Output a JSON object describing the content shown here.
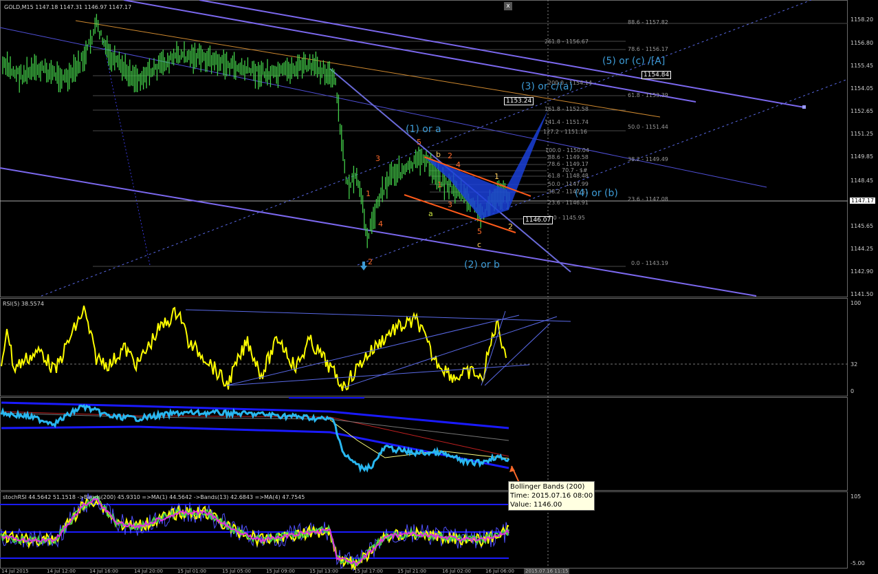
{
  "main": {
    "title": "GOLD,M15  1147.18 1147.31 1146.97 1147.17",
    "close_label": "x",
    "price_axis": [
      "1158.20",
      "1156.80",
      "1155.45",
      "1154.05",
      "1152.65",
      "1151.25",
      "1149.85",
      "1148.45",
      "1147.17",
      "1145.65",
      "1144.25",
      "1142.90",
      "1141.50"
    ],
    "current_price": "1147.17",
    "fib_levels": [
      {
        "label": "88.6 - 1157.82"
      },
      {
        "label": "261.8 - 1156.67"
      },
      {
        "label": "78.6 - 1156.17"
      },
      {
        "label": "200.0 - 1154.14"
      },
      {
        "label": "61.8 - 1153.39"
      },
      {
        "label": "161.8 - 1152.58"
      },
      {
        "label": "141.4 - 1151.74"
      },
      {
        "label": "50.0 - 1151.44"
      },
      {
        "label": "127.2 - 1151.16"
      },
      {
        "label": "100.0 - 1150.04"
      },
      {
        "label": "88.6 - 1149.58"
      },
      {
        "label": "38.2 - 1149.49"
      },
      {
        "label": "78.6 - 1149.17"
      },
      {
        "label": "70.7 - $#"
      },
      {
        "label": "61.8 - 1148.48"
      },
      {
        "label": "50.0 - 1147.99"
      },
      {
        "label": "38.2 - 1147.51"
      },
      {
        "label": "23.6 - 1147.08"
      },
      {
        "label": "23.6 - 1146.91"
      },
      {
        "label": "0.0 - 1145.95"
      },
      {
        "label": "0.0 - 1143.19"
      }
    ],
    "wave_labels": [
      {
        "text": "(5) or (c) /[A]"
      },
      {
        "text": "(3) or c/(a)"
      },
      {
        "text": "(1) or a"
      },
      {
        "text": "(4) or (b)"
      },
      {
        "text": "(2) or b"
      }
    ],
    "small_labels": [
      {
        "text": "3",
        "color": "#ff6a2a"
      },
      {
        "text": "1",
        "color": "#ff6a2a"
      },
      {
        "text": "4",
        "color": "#ff6a2a"
      },
      {
        "text": "2",
        "color": "#ff6a2a"
      },
      {
        "text": "5",
        "color": "#ff6a2a"
      },
      {
        "text": "b",
        "color": "#ffd060"
      },
      {
        "text": "2",
        "color": "#ff6a2a"
      },
      {
        "text": "1",
        "color": "#ff6a2a"
      },
      {
        "text": "4",
        "color": "#ff6a2a"
      },
      {
        "text": "3",
        "color": "#ff6a2a"
      },
      {
        "text": "a",
        "color": "#c8e040"
      },
      {
        "text": "5",
        "color": "#ff6a2a"
      },
      {
        "text": "c",
        "color": "#ffd060"
      },
      {
        "text": "1",
        "color": "#ffd060"
      },
      {
        "text": "2",
        "color": "#ffd060"
      }
    ],
    "price_boxes": [
      "1154.84",
      "1153.24",
      "1146.07"
    ]
  },
  "rsi": {
    "title": "RSI(5) 38.5574",
    "axis": [
      "100",
      "32",
      "0"
    ]
  },
  "boll": {
    "tooltip": {
      "line1": "Bollinger Bands (200)",
      "line2": "Time: 2015.07.16 08:00",
      "line3": "Value: 1146.00"
    }
  },
  "stoch": {
    "title": "stochRSI 44.5642 51.1518 ->Bands(200) 45.9310 =>MA(1) 44.5642 ->Bands(13) 42.6843 =>MA(4) 47.7545",
    "axis": [
      "105",
      "-5.00"
    ]
  },
  "timebar": [
    "14 Jul 2015",
    "14 Jul 12:00",
    "14 Jul 16:00",
    "14 Jul 20:00",
    "15 Jul 01:00",
    "15 Jul 05:00",
    "15 Jul 09:00",
    "15 Jul 13:00",
    "15 Jul 17:00",
    "15 Jul 21:00",
    "16 Jul 02:00",
    "16 Jul 06:00",
    "2015.07.16 11:15"
  ],
  "colors": {
    "candle": "#44d04a",
    "rsi": "#ffff00",
    "bands": "#1a1aff",
    "price": "#29b7f0",
    "channel": "#7b68ee",
    "wave": "#3d9bd6"
  }
}
